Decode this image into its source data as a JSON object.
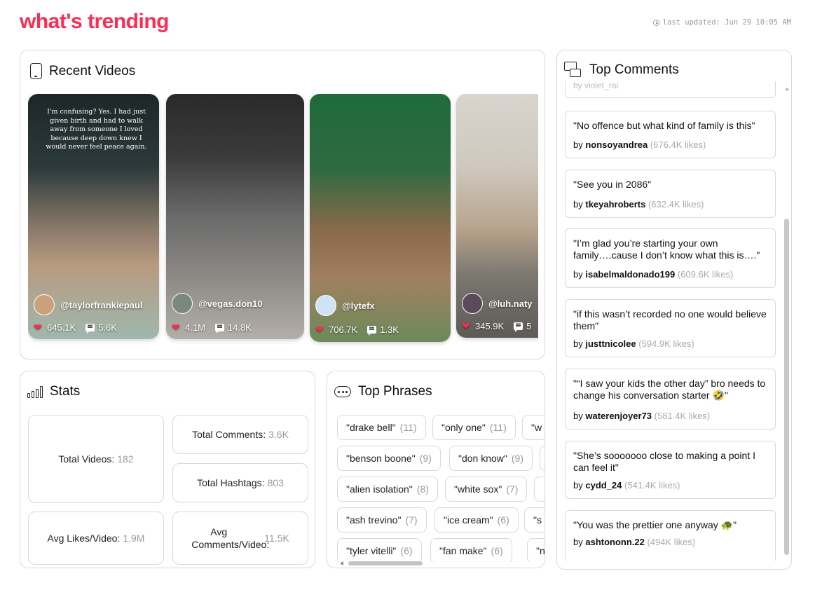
{
  "header": {
    "brand": "what's trending",
    "last_updated": "last updated: Jun 29 10:05 AM"
  },
  "recent_videos": {
    "title": "Recent Videos",
    "videos": [
      {
        "caption": "I'm confusing? Yes. I had just given birth and had to walk away from someone I loved because deep down knew I would never feel peace again.",
        "user": "@taylorfrankiepaul",
        "likes": "645.1K",
        "comments": "5.6K"
      },
      {
        "caption": "",
        "user": "@vegas.don10",
        "likes": "4.1M",
        "comments": "14.8K"
      },
      {
        "caption": "",
        "user": "@lytefx",
        "likes": "706.7K",
        "comments": "1.3K"
      },
      {
        "caption": "",
        "user": "@luh.naty",
        "likes": "345.9K",
        "comments": "5"
      }
    ]
  },
  "stats": {
    "title": "Stats",
    "total_videos_label": "Total Videos:",
    "total_videos": "182",
    "total_comments_label": "Total Comments:",
    "total_comments": "3.6K",
    "total_hashtags_label": "Total Hashtags:",
    "total_hashtags": "803",
    "avg_likes_label": "Avg Likes/Video:",
    "avg_likes": "1.9M",
    "avg_comments_label": "Avg Comments/Video:",
    "avg_comments": "11.5K"
  },
  "top_phrases": {
    "title": "Top Phrases",
    "chips": [
      {
        "phrase": "\"drake bell\"",
        "count": "(11)"
      },
      {
        "phrase": "\"only one\"",
        "count": "(11)"
      },
      {
        "phrase": "\"w",
        "count": ""
      },
      {
        "phrase": "\"benson boone\"",
        "count": "(9)"
      },
      {
        "phrase": "\"don know\"",
        "count": "(9)"
      },
      {
        "phrase": "\"alien isolation\"",
        "count": "(8)"
      },
      {
        "phrase": "\"white sox\"",
        "count": "(7)"
      },
      {
        "phrase": "\"ash trevino\"",
        "count": "(7)"
      },
      {
        "phrase": "\"ice cream\"",
        "count": "(6)"
      },
      {
        "phrase": "\"s",
        "count": ""
      },
      {
        "phrase": "\"tyler vitelli\"",
        "count": "(6)"
      },
      {
        "phrase": "\"fan make\"",
        "count": "(6)"
      },
      {
        "phrase": "\"no",
        "count": ""
      }
    ]
  },
  "top_comments": {
    "title": "Top Comments",
    "ghost_user": "by violet_rai",
    "items": [
      {
        "text": "\"No offence but what kind of family is this\"",
        "by": "by",
        "user": "nonsoyandrea",
        "likes": "(676.4K likes)"
      },
      {
        "text": "\"See you in 2086\"",
        "by": "by",
        "user": "tkeyahroberts",
        "likes": "(632.4K likes)"
      },
      {
        "text": "\"I’m glad you’re starting your own family….cause I don’t know what this is….\"",
        "by": "by",
        "user": "isabelmaldonado199",
        "likes": "(609.6K likes)"
      },
      {
        "text": "\"if this wasn’t recorded no one would believe them\"",
        "by": "by",
        "user": "justtnicolee",
        "likes": "(594.9K likes)"
      },
      {
        "text": "\"“I saw your kids the other day” bro needs to change his conversation starter 🤣\"",
        "by": "by",
        "user": "waterenjoyer73",
        "likes": "(581.4K likes)"
      },
      {
        "text": "\"She’s sooooooo close to making a point I can feel it\"",
        "by": "by",
        "user": "cydd_24",
        "likes": "(541.4K likes)"
      },
      {
        "text": "\"You was the prettier one anyway 🐢\"",
        "by": "by",
        "user": "ashtononn.22",
        "likes": "(494K likes)"
      }
    ]
  }
}
